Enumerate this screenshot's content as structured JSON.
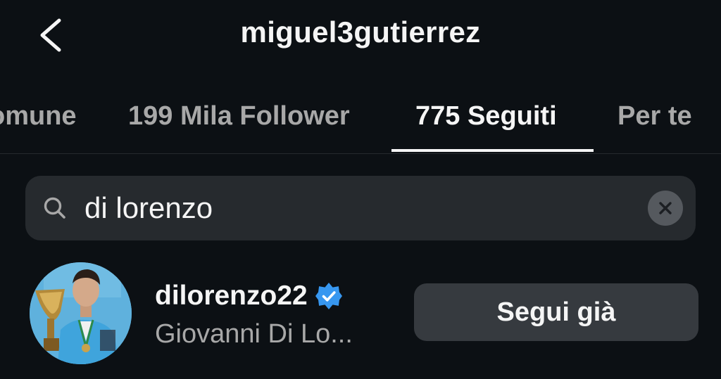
{
  "header": {
    "title": "miguel3gutierrez",
    "back_icon": "chevron-left-icon"
  },
  "tabs": [
    {
      "label": "omune",
      "active": false
    },
    {
      "label": "199 Mila Follower",
      "active": false
    },
    {
      "label": "775 Seguiti",
      "active": true
    },
    {
      "label": "Per te",
      "active": false
    }
  ],
  "search": {
    "value": "di lorenzo",
    "icon": "search-icon",
    "clear_icon": "clear-icon"
  },
  "results": [
    {
      "username": "dilorenzo22",
      "verified": true,
      "full_name": "Giovanni Di Lo...",
      "button_label": "Segui già"
    }
  ],
  "colors": {
    "background": "#0c1014",
    "verified": "#3797f0",
    "button_bg": "#363a3f",
    "search_bg": "#262a2e"
  }
}
